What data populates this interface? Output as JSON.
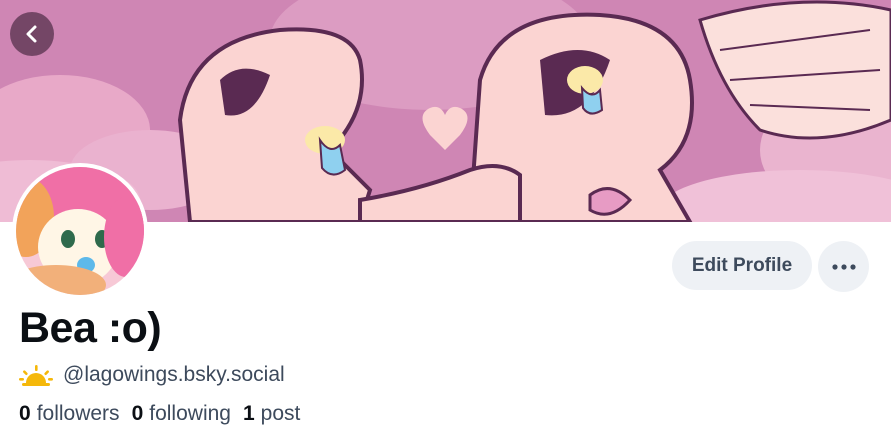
{
  "header": {
    "back_icon": "chevron-left-icon",
    "banner_colors": {
      "sky": "#d089b6",
      "cloud": "#f1c7d6",
      "character": "#fbd4d2",
      "outline": "#5a2a52"
    }
  },
  "profile": {
    "display_name": "Bea :o)",
    "handle": "@lagowings.bsky.social",
    "handle_icon": "sun-icon",
    "edit_profile_label": "Edit Profile",
    "more_icon": "ellipsis-icon",
    "stats": {
      "followers_count": "0",
      "followers_label": "followers",
      "following_count": "0",
      "following_label": "following",
      "posts_count": "1",
      "posts_label": "post"
    }
  },
  "colors": {
    "accent_button_bg": "#eef1f5",
    "text_primary": "#0b0f14",
    "text_secondary": "#3d4a5c",
    "sun": "#f5b80a"
  }
}
